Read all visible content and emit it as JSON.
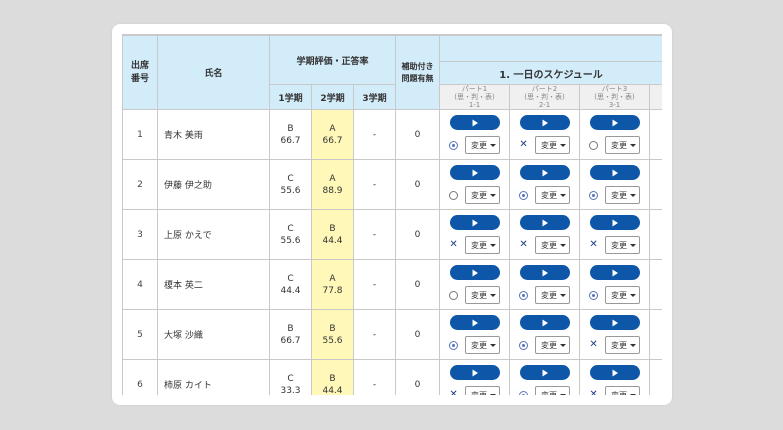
{
  "header": {
    "attendance_no": "出席番号",
    "name": "氏名",
    "eval_group": "学期評価・正答率",
    "term1": "1学期",
    "term2": "2学期",
    "term3": "3学期",
    "assisted": "補助付き問題有無",
    "schedule": "1. 一日のスケジュール",
    "parts": [
      {
        "label": "パート1",
        "sub": "(思・判・表)",
        "code": "1-1"
      },
      {
        "label": "パート2",
        "sub": "(思・判・表)",
        "code": "2-1"
      },
      {
        "label": "パート3",
        "sub": "(思・判・表)",
        "code": "3-1"
      }
    ]
  },
  "change_label": "変更",
  "colors": {
    "header_bg": "#d3ecfa",
    "highlight": "#fff8b8",
    "play_button": "#0e56a8"
  },
  "students": [
    {
      "no": "1",
      "name": "青木 美雨",
      "t1_grade": "B",
      "t1_score": "66.7",
      "t2_grade": "A",
      "t2_score": "66.7",
      "t3": "-",
      "assisted": "0",
      "marks": [
        "dot",
        "cross",
        "circle"
      ]
    },
    {
      "no": "2",
      "name": "伊藤 伊之助",
      "t1_grade": "C",
      "t1_score": "55.6",
      "t2_grade": "A",
      "t2_score": "88.9",
      "t3": "-",
      "assisted": "0",
      "marks": [
        "circle",
        "dot",
        "dot"
      ]
    },
    {
      "no": "3",
      "name": "上原 かえで",
      "t1_grade": "C",
      "t1_score": "55.6",
      "t2_grade": "B",
      "t2_score": "44.4",
      "t3": "-",
      "assisted": "0",
      "marks": [
        "cross",
        "cross",
        "cross"
      ]
    },
    {
      "no": "4",
      "name": "榎本 英二",
      "t1_grade": "C",
      "t1_score": "44.4",
      "t2_grade": "A",
      "t2_score": "77.8",
      "t3": "-",
      "assisted": "0",
      "marks": [
        "circle",
        "dot",
        "dot"
      ]
    },
    {
      "no": "5",
      "name": "大塚 沙織",
      "t1_grade": "B",
      "t1_score": "66.7",
      "t2_grade": "B",
      "t2_score": "55.6",
      "t3": "-",
      "assisted": "0",
      "marks": [
        "dot",
        "dot",
        "cross"
      ]
    },
    {
      "no": "6",
      "name": "柿原 カイト",
      "t1_grade": "C",
      "t1_score": "33.3",
      "t2_grade": "B",
      "t2_score": "44.4",
      "t3": "-",
      "assisted": "0",
      "marks": [
        "cross",
        "dot",
        "cross"
      ]
    }
  ]
}
